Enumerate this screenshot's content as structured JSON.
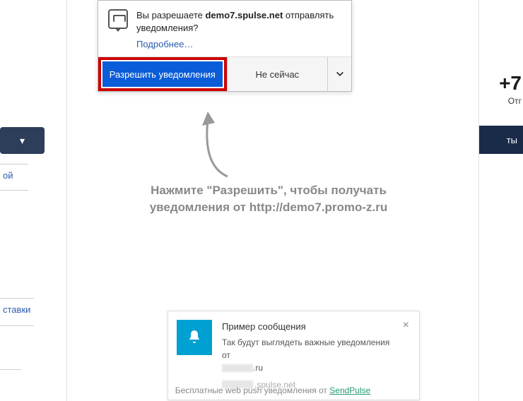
{
  "sidebar": {
    "frag1": "ой",
    "frag2": "ставки",
    "frag3": ""
  },
  "right": {
    "phone": "+7",
    "sub": "Отг",
    "btn": "ты"
  },
  "prompt": {
    "line_prefix": "Вы разрешаете ",
    "domain": "demo7.spulse.net",
    "line_suffix": " отправлять уведомления?",
    "more": "Подробнее…",
    "allow": "Разрешить уведомления",
    "not_now": "Не сейчас"
  },
  "instruction": {
    "line1": "Нажмите \"Разрешить\", чтобы получать",
    "line2": "уведомления от http://demo7.promo-z.ru"
  },
  "sample": {
    "title": "Пример сообщения",
    "body": "Так будут выглядеть важные уведомления от",
    "domain_suffix": ".ru",
    "source_suffix": ".spulse.net"
  },
  "credit": {
    "text": "Бесплатные web push уведомления от ",
    "link": "SendPulse"
  }
}
